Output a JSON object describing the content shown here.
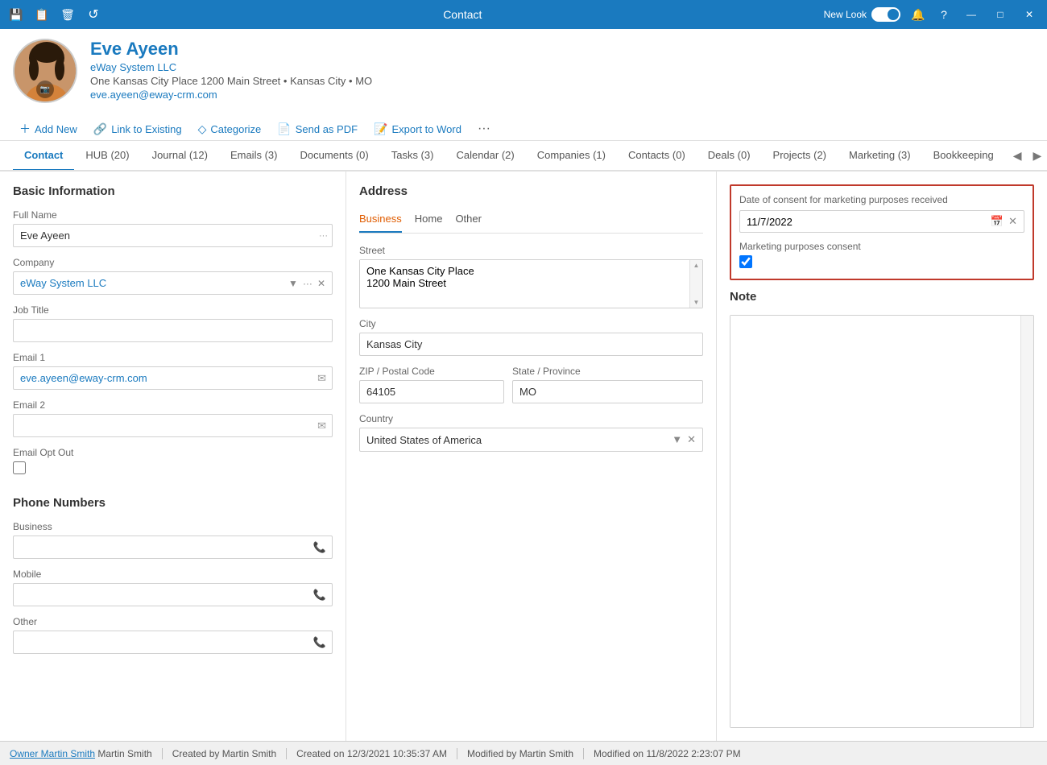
{
  "titlebar": {
    "title": "Contact",
    "new_look_label": "New Look",
    "icons": {
      "save": "💾",
      "save_as": "📄",
      "delete": "🗑",
      "refresh": "↺",
      "question": "?",
      "minimize": "—",
      "maximize": "□",
      "close": "✕"
    }
  },
  "header": {
    "contact_name": "Eve Ayeen",
    "company_name": "eWay System LLC",
    "address_line": "One Kansas City Place 1200 Main Street • Kansas City • MO",
    "email": "eve.ayeen@eway-crm.com",
    "actions": {
      "add_new": "Add New",
      "link_to_existing": "Link to Existing",
      "categorize": "Categorize",
      "send_as_pdf": "Send as PDF",
      "export_to_word": "Export to Word",
      "more": "···"
    }
  },
  "tabs": {
    "items": [
      {
        "label": "Contact",
        "active": true
      },
      {
        "label": "HUB (20)",
        "active": false
      },
      {
        "label": "Journal (12)",
        "active": false
      },
      {
        "label": "Emails (3)",
        "active": false
      },
      {
        "label": "Documents (0)",
        "active": false
      },
      {
        "label": "Tasks (3)",
        "active": false
      },
      {
        "label": "Calendar (2)",
        "active": false
      },
      {
        "label": "Companies (1)",
        "active": false
      },
      {
        "label": "Contacts (0)",
        "active": false
      },
      {
        "label": "Deals (0)",
        "active": false
      },
      {
        "label": "Projects (2)",
        "active": false
      },
      {
        "label": "Marketing (3)",
        "active": false
      },
      {
        "label": "Bookkeeping",
        "active": false
      }
    ]
  },
  "basic_info": {
    "section_title": "Basic Information",
    "full_name_label": "Full Name",
    "full_name_value": "Eve Ayeen",
    "company_label": "Company",
    "company_value": "eWay System LLC",
    "job_title_label": "Job Title",
    "job_title_value": "",
    "email1_label": "Email 1",
    "email1_value": "eve.ayeen@eway-crm.com",
    "email2_label": "Email 2",
    "email2_value": "",
    "email_opt_out_label": "Email Opt Out"
  },
  "phone_numbers": {
    "section_title": "Phone Numbers",
    "business_label": "Business",
    "business_value": "",
    "mobile_label": "Mobile",
    "mobile_value": "",
    "other_label": "Other",
    "other_value": ""
  },
  "address": {
    "section_title": "Address",
    "tabs": [
      "Business",
      "Home",
      "Other"
    ],
    "active_tab": "Business",
    "street_label": "Street",
    "street_line1": "One Kansas City Place",
    "street_line2": "1200 Main Street",
    "city_label": "City",
    "city_value": "Kansas City",
    "zip_label": "ZIP / Postal Code",
    "zip_value": "64105",
    "state_label": "State / Province",
    "state_value": "MO",
    "country_label": "Country",
    "country_value": "United States of America"
  },
  "consent": {
    "date_label": "Date of consent for marketing purposes received",
    "date_value": "11/7/2022",
    "consent_label": "Marketing purposes consent",
    "consent_checked": true
  },
  "note": {
    "section_title": "Note",
    "value": ""
  },
  "statusbar": {
    "owner_label": "Owner",
    "owner_value": "Martin Smith",
    "created_by_label": "Created by",
    "created_by_value": "Martin Smith",
    "created_on_label": "Created on",
    "created_on_value": "12/3/2021 10:35:37 AM",
    "modified_by_label": "Modified by",
    "modified_by_value": "Martin Smith",
    "modified_on_label": "Modified on",
    "modified_on_value": "11/8/2022 2:23:07 PM"
  }
}
